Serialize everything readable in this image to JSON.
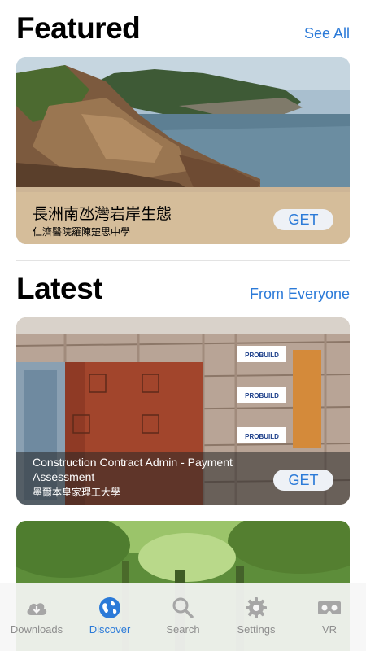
{
  "featured": {
    "title": "Featured",
    "link_label": "See All",
    "card": {
      "title": "長洲南氹灣岩岸生態",
      "subtitle": "仁濟醫院羅陳楚思中學",
      "button_label": "GET"
    }
  },
  "latest": {
    "title": "Latest",
    "link_label": "From Everyone",
    "cards": [
      {
        "title_line1": "Construction Contract Admin - Payment",
        "title_line2": "Assessment",
        "subtitle": "墨爾本皇家理工大學",
        "button_label": "GET",
        "sign_text": "PROBUILD"
      }
    ]
  },
  "tabbar": {
    "items": [
      {
        "label": "Downloads",
        "icon": "cloud-download-icon",
        "active": false
      },
      {
        "label": "Discover",
        "icon": "globe-icon",
        "active": true
      },
      {
        "label": "Search",
        "icon": "magnifier-icon",
        "active": false
      },
      {
        "label": "Settings",
        "icon": "gear-icon",
        "active": false
      },
      {
        "label": "VR",
        "icon": "vr-headset-icon",
        "active": false
      }
    ]
  },
  "colors": {
    "accent": "#2b7ad8",
    "inactive": "#8e8e8e",
    "get_button_bg": "#eef1f6"
  }
}
